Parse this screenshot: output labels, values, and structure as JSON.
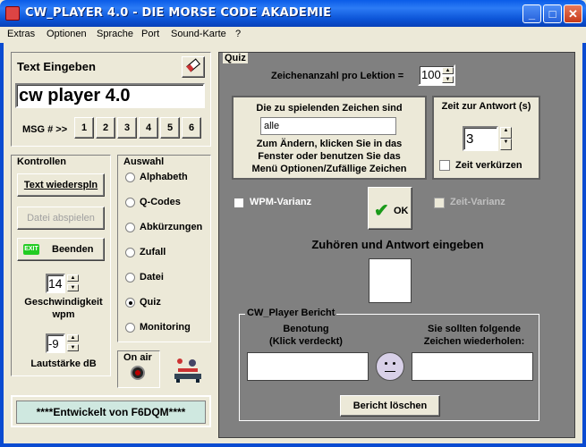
{
  "window": {
    "title": "CW_PLAYER 4.0 - DIE MORSE CODE AKADEMIE"
  },
  "menu": [
    "Extras",
    "Optionen",
    "Sprache",
    "Port",
    "Sound-Karte",
    "?"
  ],
  "text_input": {
    "label": "Text Eingeben",
    "value": "cw player 4.0",
    "msg_label": "MSG # >>",
    "msg_buttons": [
      "1",
      "2",
      "3",
      "4",
      "5",
      "6"
    ]
  },
  "controls": {
    "label": "Kontrollen",
    "replay": "Text wiederspln",
    "play_file": "Datei abspielen",
    "quit": "Beenden",
    "speed_value": "14",
    "speed_label": "Geschwindigkeit",
    "speed_unit": "wpm",
    "volume_value": "-9",
    "volume_label": "Lautstärke dB"
  },
  "selection": {
    "label": "Auswahl",
    "options": [
      "Alphabeth",
      "Q-Codes",
      "Abkürzungen",
      "Zufall",
      "Datei",
      "Quiz",
      "Monitoring"
    ],
    "selected": "Quiz"
  },
  "on_air": {
    "label": "On air"
  },
  "credit": "****Entwickelt von F6DQM****",
  "quiz": {
    "label": "Quiz",
    "chars_per_lesson_label": "Zeichenanzahl pro Lektion =",
    "chars_per_lesson_value": "100",
    "chars_box_title": "Die zu spielenden Zeichen sind",
    "chars_value": "alle",
    "chars_help_1": "Zum Ändern, klicken Sie in das",
    "chars_help_2": "Fenster oder benutzen Sie das",
    "chars_help_3": "Menü Optionen/Zufällige Zeichen",
    "answer_time_label": "Zeit zur Antwort (s)",
    "answer_time_value": "3",
    "shorten_time_label": "Zeit verkürzen",
    "wpm_variance": "WPM-Varianz",
    "ok": "OK",
    "time_variance": "Zeit-Varianz",
    "listen_label": "Zuhören und Antwort eingeben",
    "report_label": "CW_Player Bericht",
    "grade_label_1": "Benotung",
    "grade_label_2": "(Klick verdeckt)",
    "repeat_label_1": "Sie sollten folgende",
    "repeat_label_2": "Zeichen wiederholen:",
    "clear_report": "Bericht löschen"
  }
}
